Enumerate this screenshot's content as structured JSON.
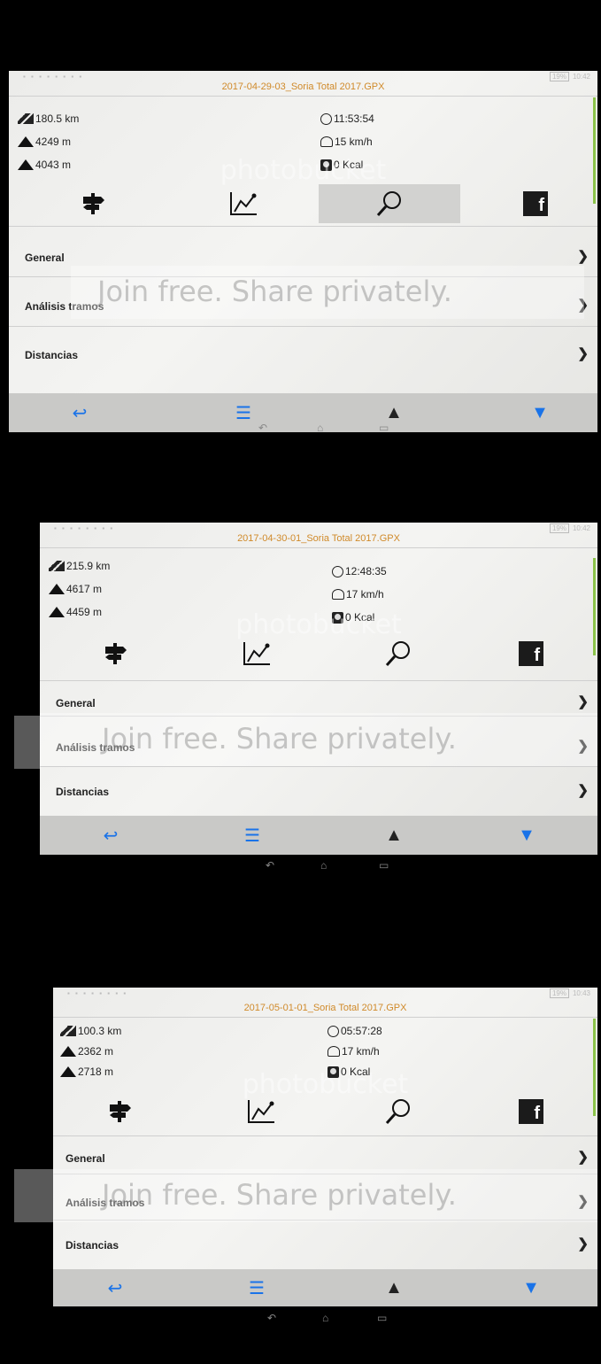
{
  "screens": [
    {
      "status_time": "10:42",
      "battery": "19%",
      "title": "2017-04-29-03_Soria Total 2017.GPX",
      "distance": "180.5 km",
      "ascent": "4249 m",
      "descent": "4043 m",
      "duration": "11:53:54",
      "speed": "15 km/h",
      "calories": "0 Kcal",
      "menu": [
        "General",
        "Análisis tramos",
        "Distancias"
      ]
    },
    {
      "status_time": "10:42",
      "battery": "19%",
      "title": "2017-04-30-01_Soria Total 2017.GPX",
      "distance": "215.9 km",
      "ascent": "4617 m",
      "descent": "4459 m",
      "duration": "12:48:35",
      "speed": "17 km/h",
      "calories": "0 Kcal",
      "menu": [
        "General",
        "Análisis tramos",
        "Distancias"
      ]
    },
    {
      "status_time": "10:43",
      "battery": "19%",
      "title": "2017-05-01-01_Soria Total 2017.GPX",
      "distance": "100.3 km",
      "ascent": "2362 m",
      "descent": "2718 m",
      "duration": "05:57:28",
      "speed": "17 km/h",
      "calories": "0 Kcal",
      "menu": [
        "General",
        "Análisis tramos",
        "Distancias"
      ]
    }
  ],
  "watermark": {
    "logo": "photobucket",
    "banner": "Join free. Share privately."
  },
  "toolbar_icons": [
    "signpost-icon",
    "chart-icon",
    "search-icon",
    "facebook-icon"
  ],
  "nav_icons": [
    "back-arrow-icon",
    "menu-icon",
    "chevron-up-icon",
    "chevron-down-icon"
  ],
  "facebook_glyph": "f",
  "colors": {
    "title": "#d08a2a",
    "nav_blue": "#1a73e8",
    "navbar_bg": "#c9c9c7"
  }
}
